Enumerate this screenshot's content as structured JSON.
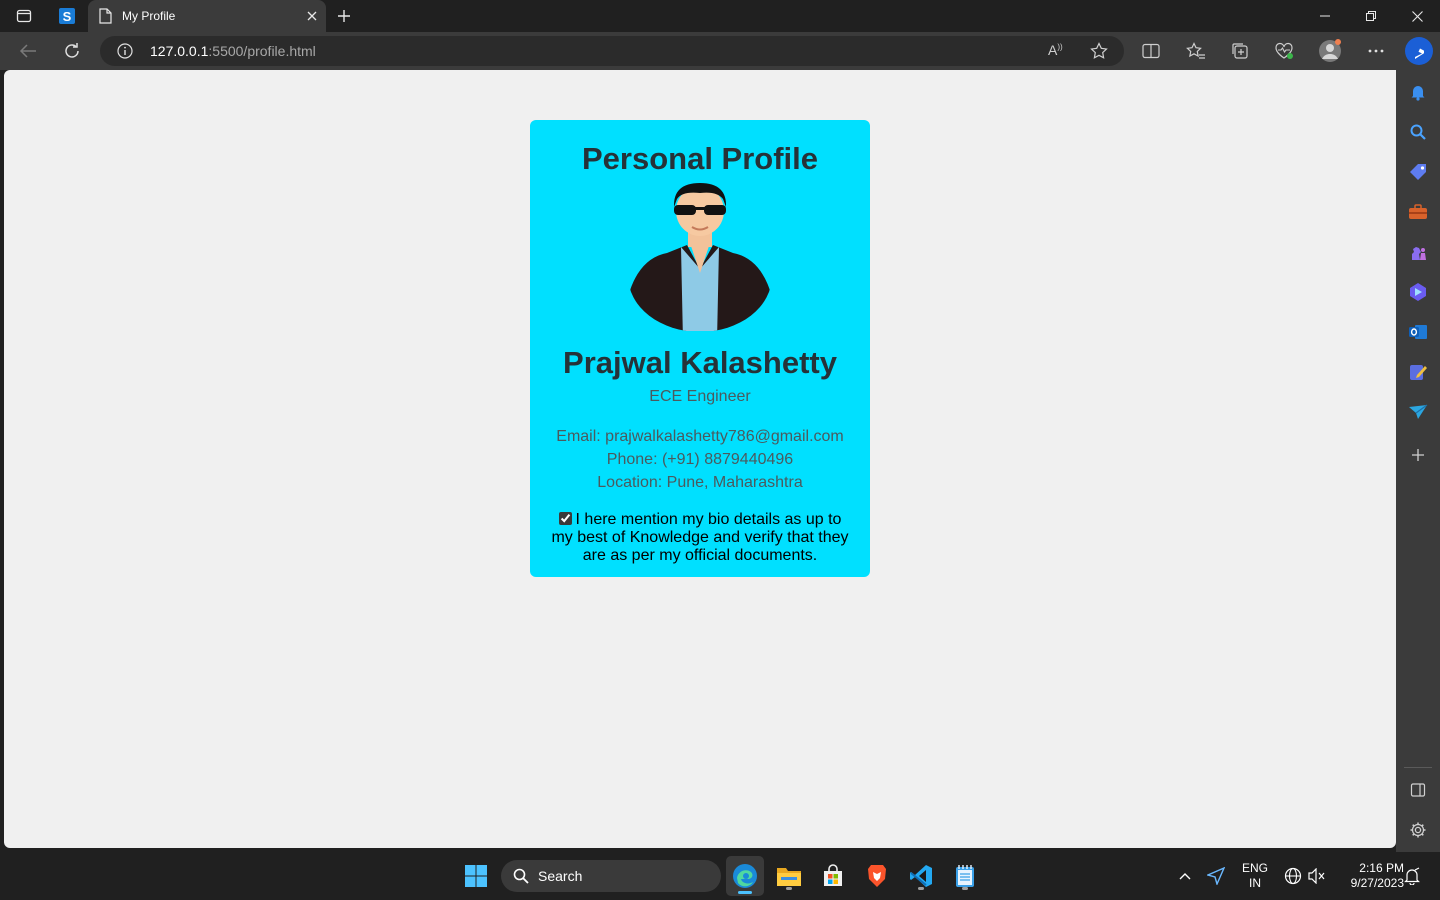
{
  "browser": {
    "tab_title": "My Profile",
    "url_host": "127.0.0.1",
    "url_rest": ":5500/profile.html"
  },
  "profile": {
    "heading": "Personal Profile",
    "name": "Prajwal Kalashetty",
    "role": "ECE Engineer",
    "email": "Email: prajwalkalashetty786@gmail.com",
    "phone": "Phone: (+91) 8879440496",
    "location": "Location: Pune, Maharashtra",
    "consent_text": "I here mention my bio details as up to my best of Knowledge and verify that they are as per my official documents.",
    "consent_checked": true
  },
  "taskbar": {
    "search_label": "Search",
    "lang_1": "ENG",
    "lang_2": "IN",
    "time": "2:16 PM",
    "date": "9/27/2023"
  },
  "colors": {
    "card_bg": "#00e0ff",
    "page_bg": "#f0f0f0",
    "heading": "#263238"
  }
}
